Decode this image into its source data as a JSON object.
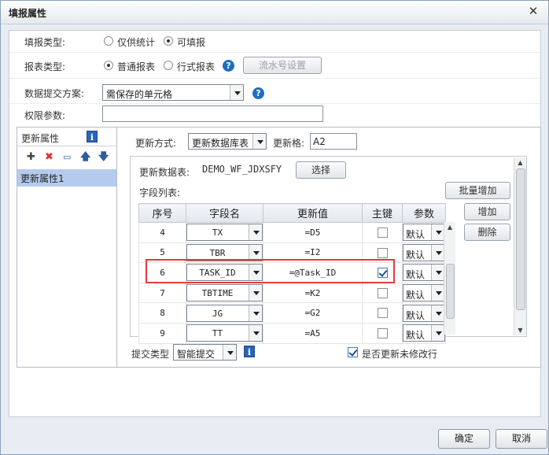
{
  "title": "填报属性",
  "fill_type": {
    "label": "填报类型:",
    "options": [
      "仅供统计",
      "可填报"
    ],
    "selected": "可填报"
  },
  "report_type": {
    "label": "报表类型:",
    "options": [
      "普通报表",
      "行式报表"
    ],
    "selected": "普通报表",
    "serial_button": "流水号设置"
  },
  "submit_scheme": {
    "label": "数据提交方案:",
    "value": "需保存的单元格"
  },
  "permission": {
    "label": "权限参数:",
    "value": ""
  },
  "left_panel": {
    "title": "更新属性",
    "items": [
      "更新属性1"
    ]
  },
  "update": {
    "mode_label": "更新方式:",
    "mode_value": "更新数据库表",
    "cell_label": "更新格:",
    "cell_value": "A2",
    "table_label": "更新数据表:",
    "table_value": "DEMO_WF_JDXSFY",
    "select_button": "选择",
    "fields_label": "字段列表:",
    "batch_add_button": "批量增加",
    "add_button": "增加",
    "delete_button": "删除"
  },
  "grid": {
    "headers": [
      "序号",
      "字段名",
      "更新值",
      "主键",
      "参数"
    ],
    "rows": [
      {
        "no": "4",
        "field": "TX",
        "value": "=D5",
        "key": false,
        "param": "默认"
      },
      {
        "no": "5",
        "field": "TBR",
        "value": "=I2",
        "key": false,
        "param": "默认"
      },
      {
        "no": "6",
        "field": "TASK_ID",
        "value": "=@Task_ID",
        "key": true,
        "param": "默认"
      },
      {
        "no": "7",
        "field": "TBTIME",
        "value": "=K2",
        "key": false,
        "param": "默认"
      },
      {
        "no": "8",
        "field": "JG",
        "value": "=G2",
        "key": false,
        "param": "默认"
      },
      {
        "no": "9",
        "field": "TT",
        "value": "=A5",
        "key": false,
        "param": "默认"
      }
    ]
  },
  "submit": {
    "type_label": "提交类型",
    "type_value": "智能提交",
    "update_unmodified_label": "是否更新未修改行",
    "update_unmodified": true
  },
  "footer": {
    "ok": "确定",
    "cancel": "取消"
  },
  "colors": {
    "accent": "#1f6fbf",
    "selected_row": "#b5cbee",
    "highlight": "#e23b3b"
  }
}
